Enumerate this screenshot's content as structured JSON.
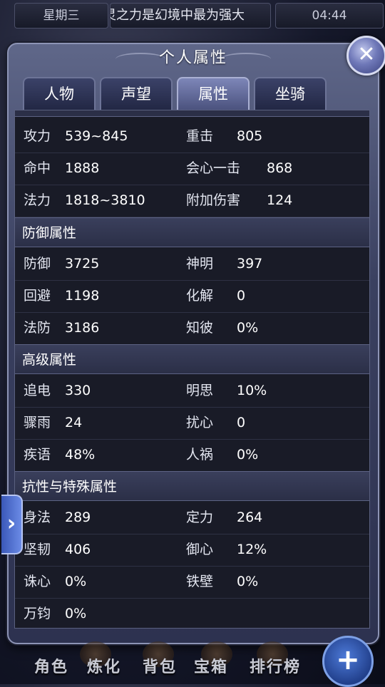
{
  "status_bar": {
    "day": "星期三",
    "marquee": "灵之力是幻境中最为强大",
    "time": "04:44"
  },
  "panel": {
    "title": "个人属性",
    "close_icon": "close-icon"
  },
  "tabs": [
    {
      "label": "人物",
      "active": false
    },
    {
      "label": "声望",
      "active": false
    },
    {
      "label": "属性",
      "active": true
    },
    {
      "label": "坐骑",
      "active": false
    }
  ],
  "attack_rows": [
    {
      "k1": "攻力",
      "v1": "539~845",
      "k2": "重击",
      "v2": "805"
    },
    {
      "k1": "命中",
      "v1": "1888",
      "k2": "会心一击",
      "v2": "868"
    },
    {
      "k1": "法力",
      "v1": "1818~3810",
      "k2": "附加伤害",
      "v2": "124"
    }
  ],
  "defense": {
    "header": "防御属性",
    "rows": [
      {
        "k1": "防御",
        "v1": "3725",
        "k2": "神明",
        "v2": "397"
      },
      {
        "k1": "回避",
        "v1": "1198",
        "k2": "化解",
        "v2": "0"
      },
      {
        "k1": "法防",
        "v1": "3186",
        "k2": "知彼",
        "v2": "0%"
      }
    ]
  },
  "advanced": {
    "header": "高级属性",
    "rows": [
      {
        "k1": "追电",
        "v1": "330",
        "k2": "明思",
        "v2": "10%"
      },
      {
        "k1": "骤雨",
        "v1": "24",
        "k2": "扰心",
        "v2": "0"
      },
      {
        "k1": "疾语",
        "v1": "48%",
        "k2": "人祸",
        "v2": "0%"
      }
    ]
  },
  "resist": {
    "header": "抗性与特殊属性",
    "rows": [
      {
        "k1": "身法",
        "v1": "289",
        "k2": "定力",
        "v2": "264"
      },
      {
        "k1": "坚韧",
        "v1": "406",
        "k2": "御心",
        "v2": "12%"
      },
      {
        "k1": "诛心",
        "v1": "0%",
        "k2": "铁壁",
        "v2": "0%"
      },
      {
        "k1": "万钧",
        "v1": "0%"
      }
    ]
  },
  "bottom_nav": [
    {
      "label": "角色"
    },
    {
      "label": "炼化"
    },
    {
      "label": "背包"
    },
    {
      "label": "宝箱"
    },
    {
      "label": "排行榜"
    }
  ],
  "plus_button": "+"
}
